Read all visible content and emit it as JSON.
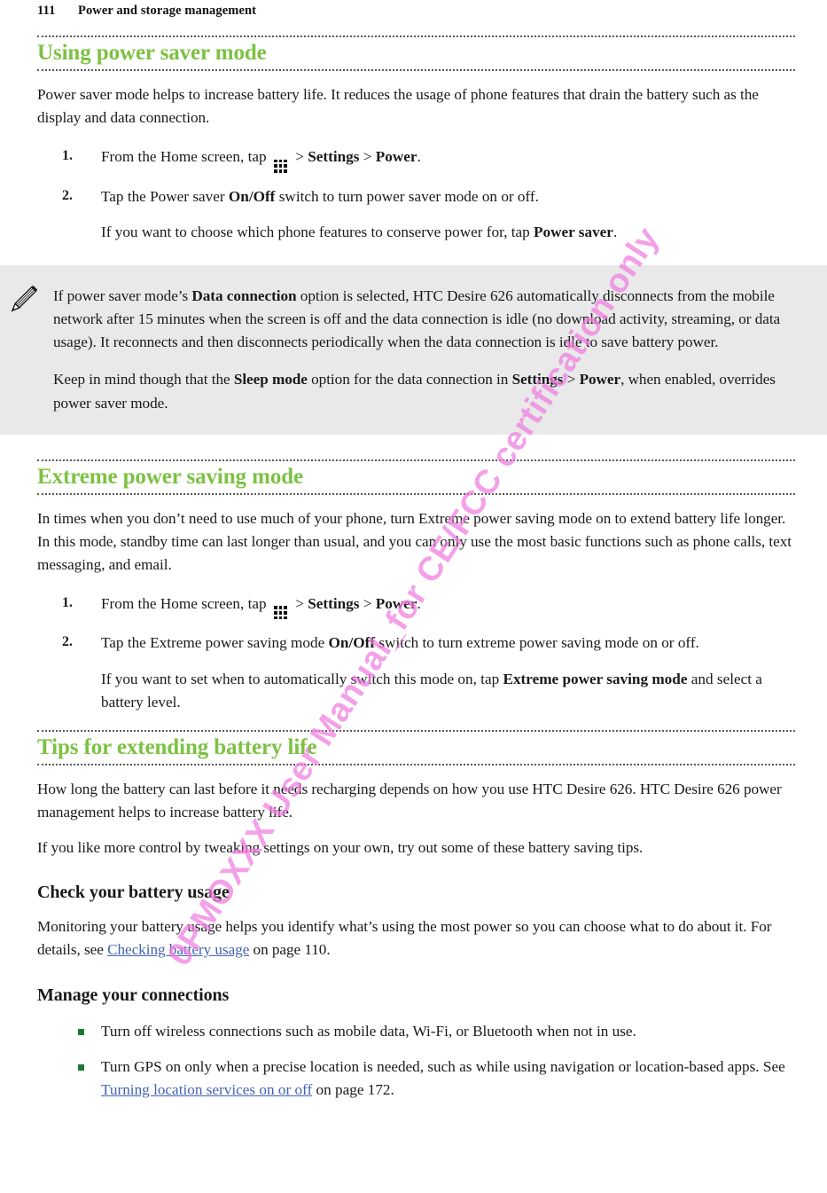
{
  "page": {
    "number": "111",
    "running_head": "Power and storage management",
    "watermark": "0PMOXXX User Manual_for CE/FCC certification only",
    "accent_green": "#7cc242",
    "link_blue": "#4362b4",
    "note_bg": "#e9e9e9",
    "watermark_color": "#f07ce0"
  },
  "sections": {
    "power_saver": {
      "heading": "Using power saver mode",
      "intro": "Power saver mode helps to increase battery life. It reduces the usage of phone features that drain the battery such as the display and data connection.",
      "steps": [
        {
          "pre_icon": "From the Home screen, tap",
          "icon": "app-grid-icon",
          "post_icon_1": "> ",
          "bold_1": "Settings",
          "mid": " > ",
          "bold_2": "Power",
          "tail": "."
        },
        {
          "lead": "Tap the Power saver ",
          "bold_1": "On/Off",
          "tail": " switch to turn power saver mode on or off.",
          "sub_lead": "If you want to choose which phone features to conserve power for, tap ",
          "sub_bold": "Power saver",
          "sub_tail": "."
        }
      ],
      "note": {
        "icon": "pencil-note-icon",
        "para_1_a": "If power saver mode’s ",
        "para_1_bold": "Data connection",
        "para_1_b": " option is selected, HTC Desire 626 automatically disconnects from the mobile network after 15 minutes when the screen is off and the data connection is idle (no download activity, streaming, or data usage). It reconnects and then disconnects periodically when the data connection is idle to save battery power.",
        "para_2_a": "Keep in mind though that the ",
        "para_2_bold_1": "Sleep mode",
        "para_2_b": " option for the data connection in ",
        "para_2_bold_2": "Settings",
        "para_2_c": " > ",
        "para_2_bold_3": "Power",
        "para_2_d": ", when enabled, overrides power saver mode."
      }
    },
    "extreme_power": {
      "heading": "Extreme power saving mode",
      "intro": "In times when you don’t need to use much of your phone, turn Extreme power saving mode on to extend battery life longer. In this mode, standby time can last longer than usual, and you can only use the most basic functions such as phone calls, text messaging, and email.",
      "steps": [
        {
          "pre_icon": "From the Home screen, tap",
          "icon": "app-grid-icon",
          "post_icon_1": "> ",
          "bold_1": "Settings",
          "mid": " > ",
          "bold_2": "Power",
          "tail": "."
        },
        {
          "lead": "Tap the Extreme power saving mode ",
          "bold_1": "On/Off",
          "tail": " switch to turn extreme power saving mode on or off.",
          "sub_lead": "If you want to set when to automatically switch this mode on, tap ",
          "sub_bold": "Extreme power saving mode",
          "sub_tail": " and select a battery level."
        }
      ]
    },
    "tips": {
      "heading": "Tips for extending battery life",
      "para_1": "How long the battery can last before it needs recharging depends on how you use HTC Desire 626. HTC Desire 626 power management helps to increase battery life.",
      "para_2": "If you like more control by tweaking settings on your own, try out some of these battery saving tips.",
      "check_usage": {
        "heading": "Check your battery usage",
        "text_a": "Monitoring your battery usage helps you identify what’s using the most power so you can choose what to do about it. For details, see ",
        "link": "Checking battery usage",
        "text_b": " on page 110."
      },
      "manage_connections": {
        "heading": "Manage your connections",
        "bullets": [
          {
            "text_a": "Turn off wireless connections such as mobile data, Wi-Fi, or Bluetooth when not in use.",
            "link": "",
            "text_b": ""
          },
          {
            "text_a": "Turn GPS on only when a precise location is needed, such as while using navigation or location-based apps. See ",
            "link": "Turning location services on or off",
            "text_b": " on page 172."
          }
        ]
      }
    }
  }
}
